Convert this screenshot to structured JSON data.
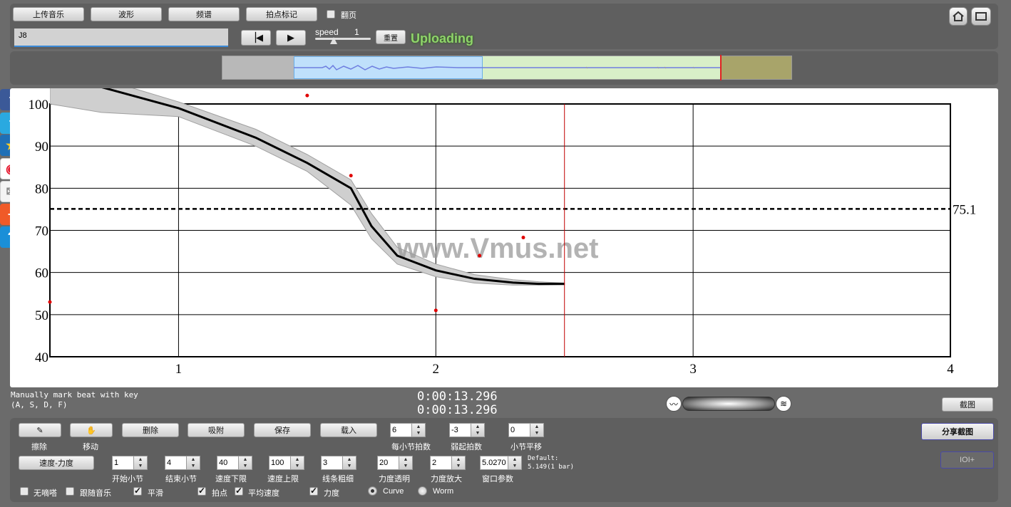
{
  "toolbar": {
    "upload_music": "上传音乐",
    "waveform": "波形",
    "spectrum": "频谱",
    "beat_mark": "拍点标记",
    "page_turn": "翻页",
    "filename": "J8",
    "speed_label": "speed",
    "speed_value": "1",
    "reset_label": "重置",
    "status": "Uploading"
  },
  "chart_data": {
    "type": "line",
    "xlim": [
      0.5,
      4
    ],
    "ylim": [
      40,
      100
    ],
    "xticks": [
      "1",
      "2",
      "3",
      "4"
    ],
    "yticks": [
      "40",
      "50",
      "60",
      "70",
      "80",
      "90",
      "100"
    ],
    "grid": true,
    "average_line": {
      "value": 75.1,
      "label": "75.1"
    },
    "playhead_x": 2.5,
    "tempo_curve": {
      "x": [
        0.5,
        0.7,
        1.0,
        1.3,
        1.5,
        1.67,
        1.75,
        1.85,
        2.0,
        2.15,
        2.3,
        2.4,
        2.5
      ],
      "y": [
        106,
        104,
        99,
        92,
        86,
        80,
        71,
        64,
        60.5,
        58.5,
        57.6,
        57.3,
        57.3
      ]
    },
    "band_upper": [
      112,
      106,
      100.5,
      94,
      88,
      82,
      74,
      66,
      62,
      59.5,
      58.3,
      57.8,
      57.5
    ],
    "band_lower": [
      100,
      98,
      97,
      90,
      84,
      76,
      68,
      62,
      59,
      57.5,
      57,
      57,
      57.1
    ],
    "beat_points": [
      {
        "x": 0.5,
        "y": 53
      },
      {
        "x": 1.5,
        "y": 102
      },
      {
        "x": 1.67,
        "y": 83
      },
      {
        "x": 2.0,
        "y": 51
      },
      {
        "x": 2.17,
        "y": 64
      },
      {
        "x": 2.34,
        "y": 68.3
      }
    ],
    "watermark": "www.Vmus.net"
  },
  "status": {
    "hint_line1": "Manually mark beat with key",
    "hint_line2": "(A, S, D, F)",
    "time1": "0:00:13.296",
    "time2": "0:00:13.296",
    "screenshot_button": "截图"
  },
  "controls": {
    "erase": "擦除",
    "move": "移动",
    "delete": "删除",
    "snap": "吸附",
    "save": "保存",
    "load": "载入",
    "beats_per_bar_value": "6",
    "beats_per_bar_label": "每小节拍数",
    "pickup_value": "-3",
    "pickup_label": "弱起拍数",
    "bar_offset_value": "0",
    "bar_offset_label": "小节平移",
    "share_button": "分享截图",
    "io_button": "IOI+",
    "tempo_dynamics": "速度-力度",
    "start_bar_value": "1",
    "start_bar_label": "开始小节",
    "end_bar_value": "4",
    "end_bar_label": "结束小节",
    "tempo_min_value": "40",
    "tempo_min_label": "速度下限",
    "tempo_max_value": "100",
    "tempo_max_label": "速度上限",
    "line_width_value": "3",
    "line_width_label": "线条粗细",
    "dyn_transparency_value": "20",
    "dyn_transparency_label": "力度透明",
    "dyn_scale_value": "2",
    "dyn_scale_label": "力度放大",
    "window_param_value": "5.0270",
    "window_param_label": "窗口参数",
    "default_line1": "Default:",
    "default_line2": "5.149(1 bar)",
    "no_beep": "无嘀嗒",
    "follow_music": "跟随音乐",
    "smooth": "平滑",
    "beats": "拍点",
    "avg_tempo": "平均速度",
    "dynamics": "力度",
    "curve": "Curve",
    "worm": "Worm"
  },
  "colors": {
    "accent_status": "#8fd46a",
    "curve": "#000000",
    "points": "#e00000",
    "playhead": "#c00000"
  }
}
